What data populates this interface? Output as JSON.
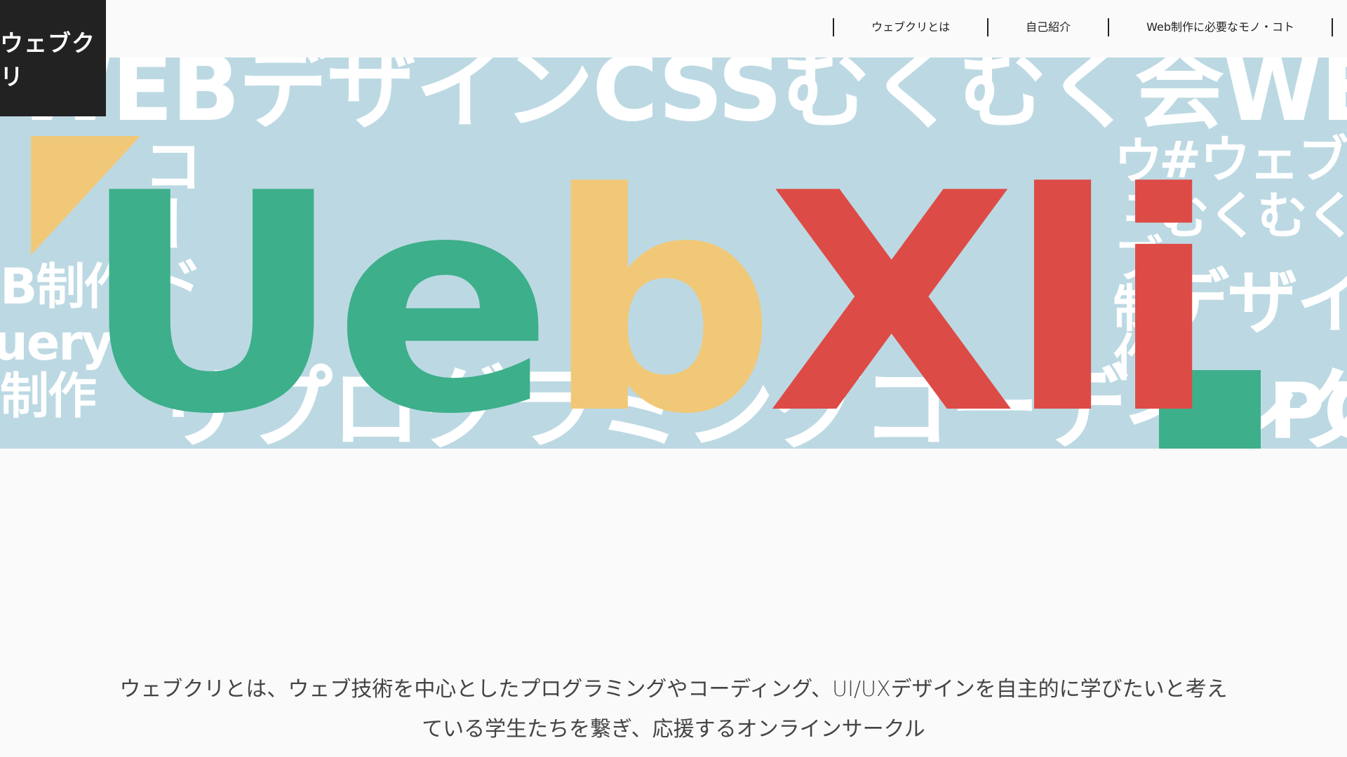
{
  "logo": {
    "text": "ウェブクリ"
  },
  "nav": {
    "items": [
      {
        "label": "ウェブクリとは"
      },
      {
        "label": "自己紹介"
      },
      {
        "label": "Web制作に必要なモノ・コト"
      }
    ]
  },
  "hero": {
    "headline_letters": [
      {
        "char": "U",
        "color": "#3daf8a"
      },
      {
        "char": "e",
        "color": "#3daf8a"
      },
      {
        "char": "b",
        "color": "#f1c878"
      },
      {
        "char": "X",
        "color": "#dd4b46"
      },
      {
        "char": "l",
        "color": "#dd4b46"
      },
      {
        "char": "i",
        "color": "#dd4b46"
      }
    ],
    "bg_texts": {
      "top": "WEBデザインCSSむくむく会WEB制",
      "bottom": "リプログラミングコーディング",
      "left1": "B制作",
      "left2": "uery",
      "left3": "制作",
      "right1": "#ウェブク",
      "right2": "むくむく",
      "right3": "デザイン",
      "right4": "PC",
      "vleft": "コード",
      "vright": "ウェブ制作"
    }
  },
  "description": {
    "line1": "ウェブクリとは、ウェブ技術を中心としたプログラミングやコーディング、UI/UXデザインを自主的に学びたいと考え",
    "line2": "ている学生たちを繋ぎ、応援するオンラインサークル"
  }
}
